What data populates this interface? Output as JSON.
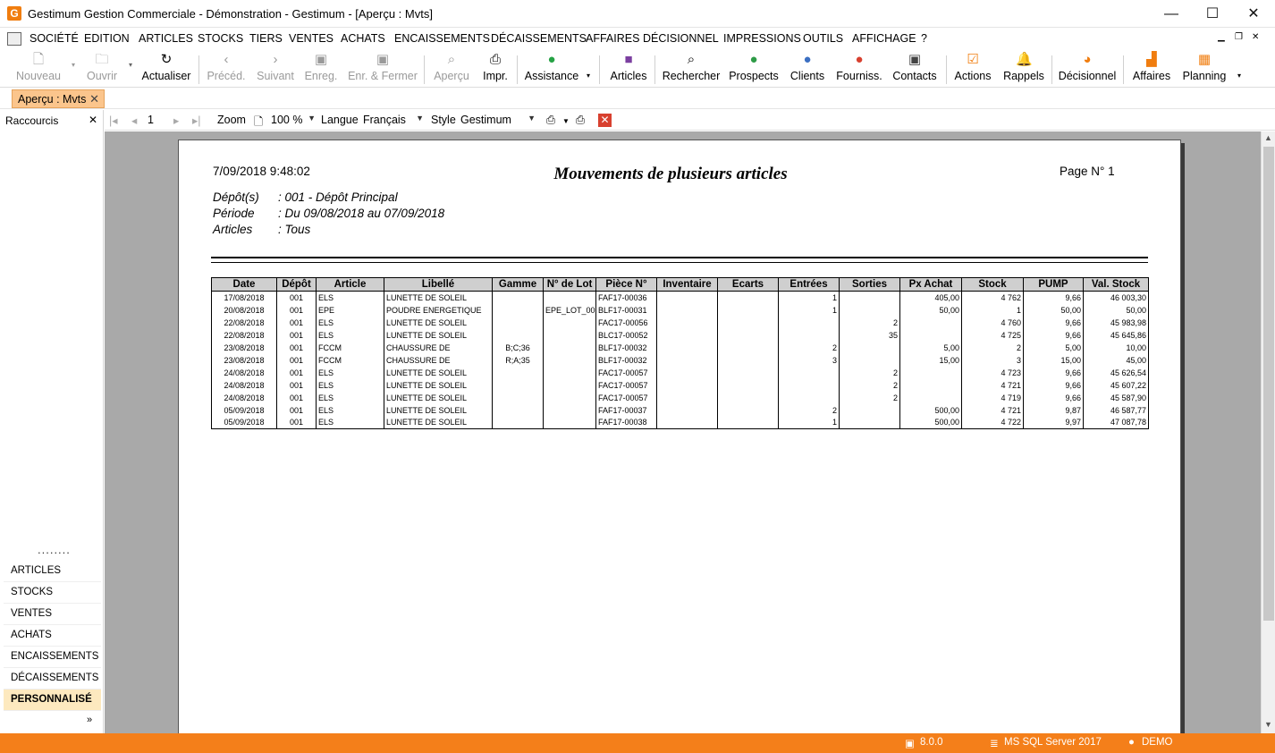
{
  "window": {
    "title": "Gestimum Gestion Commerciale - Démonstration - Gestimum - [Aperçu : Mvts]",
    "logo": "G",
    "minimize": "—",
    "maximize": "☐",
    "close": "✕"
  },
  "menu": [
    "SOCIÉTÉ",
    "EDITION",
    "ARTICLES",
    "STOCKS",
    "TIERS",
    "VENTES",
    "ACHATS",
    "ENCAISSEMENTS",
    "DÉCAISSEMENTS",
    "AFFAIRES",
    "DÉCISIONNEL",
    "IMPRESSIONS",
    "OUTILS",
    "AFFICHAGE",
    "?"
  ],
  "toolbar": {
    "nouveau": "Nouveau",
    "ouvrir": "Ouvrir",
    "actualiser": "Actualiser",
    "preced": "Précéd.",
    "suivant": "Suivant",
    "enreg": "Enreg.",
    "enr_fermer": "Enr. & Fermer",
    "apercu": "Aperçu",
    "impr": "Impr.",
    "assistance": "Assistance",
    "articles": "Articles",
    "rechercher": "Rechercher",
    "prospects": "Prospects",
    "clients": "Clients",
    "fourniss": "Fourniss.",
    "contacts": "Contacts",
    "actions": "Actions",
    "rappels": "Rappels",
    "decisionnel": "Décisionnel",
    "affaires": "Affaires",
    "planning": "Planning"
  },
  "doc_tab": {
    "label": "Aperçu : Mvts",
    "close": "✕"
  },
  "sidebar": {
    "header": "Raccourcis",
    "close": "✕",
    "items": [
      "ARTICLES",
      "STOCKS",
      "VENTES",
      "ACHATS",
      "ENCAISSEMENTS",
      "DÉCAISSEMENTS",
      "PERSONNALISÉ"
    ],
    "more": "»"
  },
  "preview_toolbar": {
    "page_number": "1",
    "zoom_label": "Zoom",
    "zoom_value": "100 %",
    "language_label": "Langue",
    "language_value": "Français",
    "style_label": "Style",
    "style_value": "Gestimum"
  },
  "report": {
    "datetime": "7/09/2018 9:48:02",
    "title": "Mouvements de plusieurs articles",
    "page": "Page N° 1",
    "filters": [
      {
        "label": "Dépôt(s)",
        "value": ": 001 - Dépôt Principal"
      },
      {
        "label": "Période",
        "value": ": Du 09/08/2018 au 07/09/2018"
      },
      {
        "label": "Articles",
        "value": ": Tous"
      }
    ],
    "columns": [
      "Date",
      "Dépôt",
      "Article",
      "Libellé",
      "Gamme",
      "N° de Lot",
      "Pièce N°",
      "Inventaire",
      "Ecarts",
      "Entrées",
      "Sorties",
      "Px Achat",
      "Stock",
      "PUMP",
      "Val. Stock"
    ],
    "rows": [
      [
        "17/08/2018",
        "001",
        "ELS",
        "LUNETTE DE SOLEIL",
        "",
        "",
        "FAF17-00036",
        "",
        "",
        "1",
        "",
        "405,00",
        "4 762",
        "9,66",
        "46 003,30"
      ],
      [
        "20/08/2018",
        "001",
        "EPE",
        "POUDRE ENERGETIQUE",
        "",
        "EPE_LOT_00",
        "BLF17-00031",
        "",
        "",
        "1",
        "",
        "50,00",
        "1",
        "50,00",
        "50,00"
      ],
      [
        "22/08/2018",
        "001",
        "ELS",
        "LUNETTE DE SOLEIL",
        "",
        "",
        "FAC17-00056",
        "",
        "",
        "",
        "2",
        "",
        "4 760",
        "9,66",
        "45 983,98"
      ],
      [
        "22/08/2018",
        "001",
        "ELS",
        "LUNETTE DE SOLEIL",
        "",
        "",
        "BLC17-00052",
        "",
        "",
        "",
        "35",
        "",
        "4 725",
        "9,66",
        "45 645,86"
      ],
      [
        "23/08/2018",
        "001",
        "FCCM",
        "CHAUSSURE DE",
        "B;C;36",
        "",
        "BLF17-00032",
        "",
        "",
        "2",
        "",
        "5,00",
        "2",
        "5,00",
        "10,00"
      ],
      [
        "23/08/2018",
        "001",
        "FCCM",
        "CHAUSSURE DE",
        "R;A;35",
        "",
        "BLF17-00032",
        "",
        "",
        "3",
        "",
        "15,00",
        "3",
        "15,00",
        "45,00"
      ],
      [
        "24/08/2018",
        "001",
        "ELS",
        "LUNETTE DE SOLEIL",
        "",
        "",
        "FAC17-00057",
        "",
        "",
        "",
        "2",
        "",
        "4 723",
        "9,66",
        "45 626,54"
      ],
      [
        "24/08/2018",
        "001",
        "ELS",
        "LUNETTE DE SOLEIL",
        "",
        "",
        "FAC17-00057",
        "",
        "",
        "",
        "2",
        "",
        "4 721",
        "9,66",
        "45 607,22"
      ],
      [
        "24/08/2018",
        "001",
        "ELS",
        "LUNETTE DE SOLEIL",
        "",
        "",
        "FAC17-00057",
        "",
        "",
        "",
        "2",
        "",
        "4 719",
        "9,66",
        "45 587,90"
      ],
      [
        "05/09/2018",
        "001",
        "ELS",
        "LUNETTE DE SOLEIL",
        "",
        "",
        "FAF17-00037",
        "",
        "",
        "2",
        "",
        "500,00",
        "4 721",
        "9,87",
        "46 587,77"
      ],
      [
        "05/09/2018",
        "001",
        "ELS",
        "LUNETTE DE SOLEIL",
        "",
        "",
        "FAF17-00038",
        "",
        "",
        "1",
        "",
        "500,00",
        "4 722",
        "9,97",
        "47 087,78"
      ]
    ]
  },
  "status": {
    "version": "8.0.0",
    "server": "MS SQL Server 2017",
    "user": "DEMO"
  },
  "colors": {
    "accent": "#f47f1a",
    "tab": "#fbc58c",
    "active_side": "#fde9bf"
  }
}
